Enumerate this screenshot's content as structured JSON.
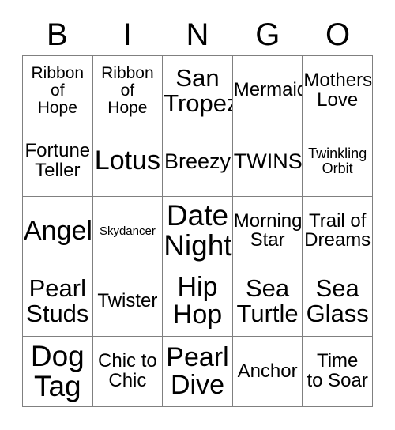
{
  "card": {
    "title": "BINGO",
    "header_letters": [
      "B",
      "I",
      "N",
      "G",
      "O"
    ],
    "colors": {
      "background": "#ffffff",
      "text": "#000000",
      "grid_line": "#808080"
    },
    "grid": {
      "columns": 5,
      "rows": 5,
      "free_space": false
    },
    "cells": [
      {
        "text": "Ribbon\nof\nHope",
        "size": "sz-md"
      },
      {
        "text": "Ribbon\nof\nHope",
        "size": "sz-md"
      },
      {
        "text": "San\nTropez",
        "size": "sz-2xl"
      },
      {
        "text": "Mermaid",
        "size": "sz-lg"
      },
      {
        "text": "Mothers\nLove",
        "size": "sz-lg"
      },
      {
        "text": "Fortune\nTeller",
        "size": "sz-lg"
      },
      {
        "text": "Lotus",
        "size": "sz-3xl"
      },
      {
        "text": "Breezy",
        "size": "sz-xl"
      },
      {
        "text": "TWINS",
        "size": "sz-xl"
      },
      {
        "text": "Twinkling\nOrbit",
        "size": "sz-sm"
      },
      {
        "text": "Angel",
        "size": "sz-3xl"
      },
      {
        "text": "Skydancer",
        "size": "sz-xs"
      },
      {
        "text": "Date\nNight",
        "size": "sz-4xl"
      },
      {
        "text": "Morning\nStar",
        "size": "sz-lg"
      },
      {
        "text": "Trail of\nDreams",
        "size": "sz-lg"
      },
      {
        "text": "Pearl\nStuds",
        "size": "sz-2xl"
      },
      {
        "text": "Twister",
        "size": "sz-lg"
      },
      {
        "text": "Hip\nHop",
        "size": "sz-3xl"
      },
      {
        "text": "Sea\nTurtle",
        "size": "sz-2xl"
      },
      {
        "text": "Sea\nGlass",
        "size": "sz-2xl"
      },
      {
        "text": "Dog\nTag",
        "size": "sz-4xl"
      },
      {
        "text": "Chic to\nChic",
        "size": "sz-lg"
      },
      {
        "text": "Pearl\nDive",
        "size": "sz-3xl"
      },
      {
        "text": "Anchor",
        "size": "sz-lg"
      },
      {
        "text": "Time\nto Soar",
        "size": "sz-lg"
      }
    ]
  }
}
